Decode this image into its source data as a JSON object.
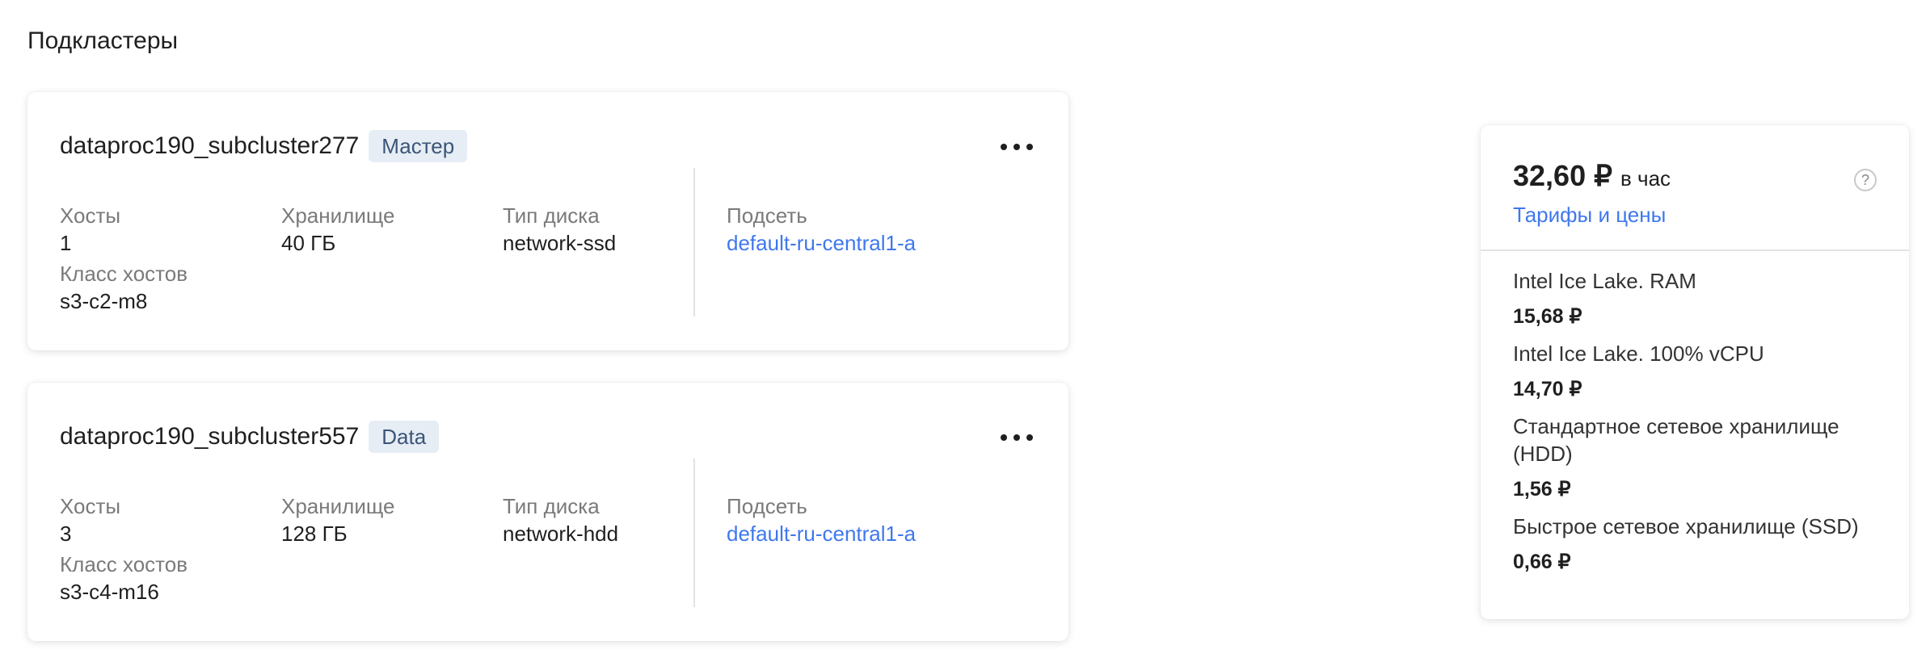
{
  "section_title": "Подкластеры",
  "subclusters": [
    {
      "name": "dataproc190_subcluster277",
      "role": "Мастер",
      "hosts_label": "Хосты",
      "hosts": "1",
      "storage_label": "Хранилище",
      "storage": "40 ГБ",
      "disk_type_label": "Тип диска",
      "disk_type": "network-ssd",
      "subnet_label": "Подсеть",
      "subnet": "default-ru-central1-a",
      "host_class_label": "Класс хостов",
      "host_class": "s3-c2-m8"
    },
    {
      "name": "dataproc190_subcluster557",
      "role": "Data",
      "hosts_label": "Хосты",
      "hosts": "3",
      "storage_label": "Хранилище",
      "storage": "128 ГБ",
      "disk_type_label": "Тип диска",
      "disk_type": "network-hdd",
      "subnet_label": "Подсеть",
      "subnet": "default-ru-central1-a",
      "host_class_label": "Класс хостов",
      "host_class": "s3-c4-m16"
    }
  ],
  "pricing": {
    "total": "32,60 ₽",
    "period": "в час",
    "help_icon": "?",
    "tariffs_link": "Тарифы и цены",
    "items": [
      {
        "name": "Intel Ice Lake. RAM",
        "price": "15,68 ₽"
      },
      {
        "name": "Intel Ice Lake. 100% vCPU",
        "price": "14,70 ₽"
      },
      {
        "name": "Стандартное сетевое хранилище (HDD)",
        "price": "1,56 ₽"
      },
      {
        "name": "Быстрое сетевое хранилище (SSD)",
        "price": "0,66 ₽"
      }
    ]
  },
  "colors": {
    "link": "#3f78ed",
    "badge_bg": "#e7edf5",
    "badge_text": "#3b5578",
    "label": "#7a7a7a"
  },
  "icons": {
    "more": "ellipsis-icon",
    "help": "question-icon"
  }
}
